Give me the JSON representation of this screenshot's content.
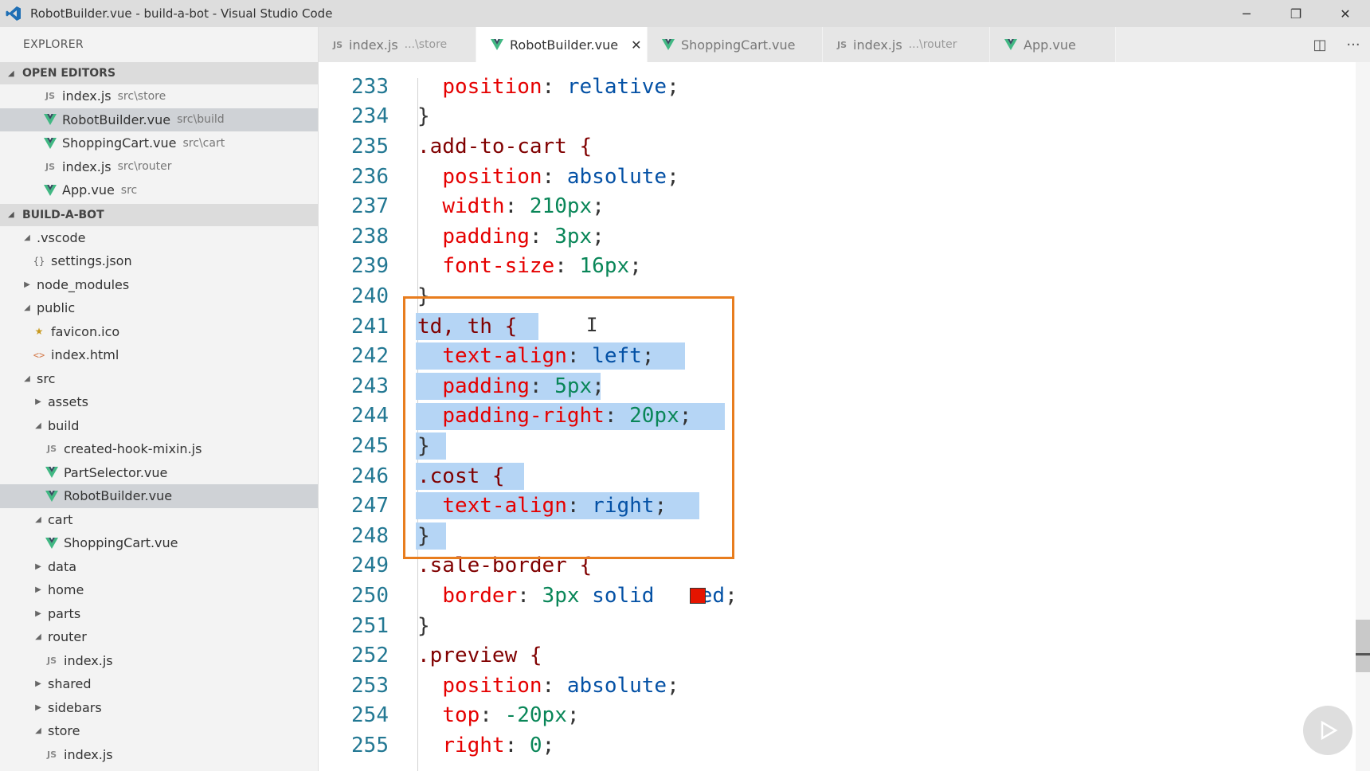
{
  "window": {
    "title": "RobotBuilder.vue - build-a-bot - Visual Studio Code",
    "controls": {
      "minimize": "─",
      "restore": "❐",
      "close": "✕"
    }
  },
  "sidebar": {
    "header": "EXPLORER",
    "open_editors": {
      "title": "OPEN EDITORS",
      "items": [
        {
          "icon": "js-icon",
          "icon_text": "JS",
          "label": "index.js",
          "desc": "src\\store"
        },
        {
          "icon": "vue-icon",
          "label": "RobotBuilder.vue",
          "desc": "src\\build"
        },
        {
          "icon": "vue-icon",
          "label": "ShoppingCart.vue",
          "desc": "src\\cart"
        },
        {
          "icon": "js-icon",
          "icon_text": "JS",
          "label": "index.js",
          "desc": "src\\router"
        },
        {
          "icon": "vue-icon",
          "label": "App.vue",
          "desc": "src"
        }
      ]
    },
    "project": {
      "title": "BUILD-A-BOT",
      "tree": [
        {
          "label": ".vscode"
        },
        {
          "label": "settings.json",
          "icon_text": "{}"
        },
        {
          "label": "node_modules"
        },
        {
          "label": "public"
        },
        {
          "label": "favicon.ico",
          "icon_text": "★"
        },
        {
          "label": "index.html",
          "icon_text": "<>"
        },
        {
          "label": "src"
        },
        {
          "label": "assets"
        },
        {
          "label": "build"
        },
        {
          "label": "created-hook-mixin.js",
          "icon_text": "JS"
        },
        {
          "label": "PartSelector.vue"
        },
        {
          "label": "RobotBuilder.vue"
        },
        {
          "label": "cart"
        },
        {
          "label": "ShoppingCart.vue"
        },
        {
          "label": "data"
        },
        {
          "label": "home"
        },
        {
          "label": "parts"
        },
        {
          "label": "router"
        },
        {
          "label": "index.js",
          "icon_text": "JS"
        },
        {
          "label": "shared"
        },
        {
          "label": "sidebars"
        },
        {
          "label": "store"
        },
        {
          "label": "index.js",
          "icon_text": "JS"
        }
      ]
    }
  },
  "tabs": [
    {
      "icon_text": "JS",
      "label": "index.js",
      "desc": "...\\store"
    },
    {
      "label": "RobotBuilder.vue",
      "close": "✕"
    },
    {
      "label": "ShoppingCart.vue"
    },
    {
      "icon_text": "JS",
      "label": "index.js",
      "desc": "...\\router"
    },
    {
      "label": "App.vue"
    }
  ],
  "tab_actions": {
    "split": "◫",
    "more": "···"
  },
  "editor": {
    "lines": [
      {
        "n": "233",
        "t": "  position: relative;"
      },
      {
        "n": "234",
        "t": "}"
      },
      {
        "n": "235",
        "t": ".add-to-cart {"
      },
      {
        "n": "236",
        "t": "  position: absolute;"
      },
      {
        "n": "237",
        "t": "  width: 210px;"
      },
      {
        "n": "238",
        "t": "  padding: 3px;"
      },
      {
        "n": "239",
        "t": "  font-size: 16px;"
      },
      {
        "n": "240",
        "t": "}"
      },
      {
        "n": "241",
        "t": "td, th {"
      },
      {
        "n": "242",
        "t": "  text-align: left;"
      },
      {
        "n": "243",
        "t": "  padding: 5px;"
      },
      {
        "n": "244",
        "t": "  padding-right: 20px;"
      },
      {
        "n": "245",
        "t": "}"
      },
      {
        "n": "246",
        "t": ".cost {"
      },
      {
        "n": "247",
        "t": "  text-align: right;"
      },
      {
        "n": "248",
        "t": "}"
      },
      {
        "n": "249",
        "t": ".sale-border {"
      },
      {
        "n": "250",
        "t": "  border: 3px solid red;"
      },
      {
        "n": "251",
        "t": "}"
      },
      {
        "n": "252",
        "t": ".preview {"
      },
      {
        "n": "253",
        "t": "  position: absolute;"
      },
      {
        "n": "254",
        "t": "  top: -20px;"
      },
      {
        "n": "255",
        "t": "  right: 0;"
      }
    ]
  },
  "colors": {
    "accent_box": "#e87d1e",
    "selection": "#b5d5f5",
    "vue_green": "#41b883",
    "swatch_red": "#e51400"
  }
}
